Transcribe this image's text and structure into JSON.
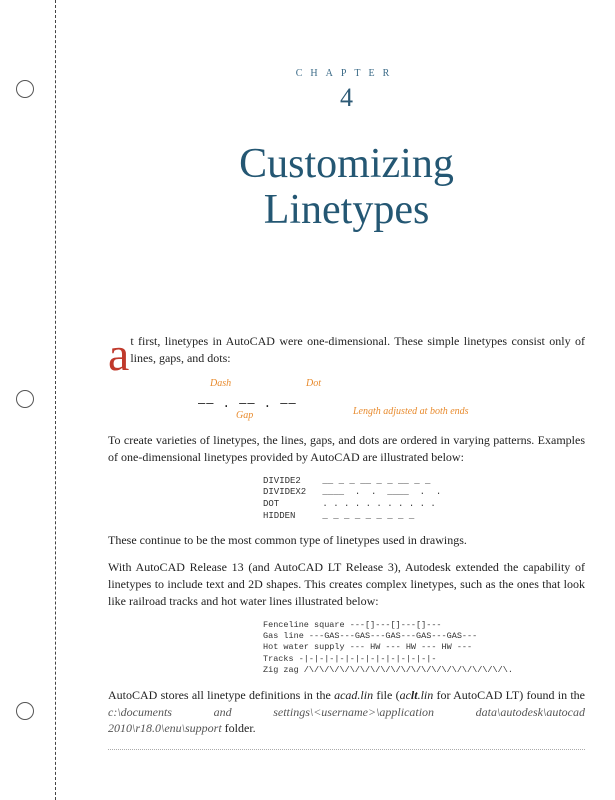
{
  "chapter": {
    "label": "chapter",
    "number": "4",
    "title_line1": "Customizing",
    "title_line2": "Linetypes"
  },
  "dropcap": "a",
  "para1_rest": "t first, linetypes in AutoCAD were one-dimensional. These simple linetypes consist only of lines, gaps, and dots:",
  "diagram1": {
    "dash": "Dash",
    "dot": "Dot",
    "gap": "Gap",
    "length": "Length adjusted at both ends",
    "line": "——  . ——  . ——"
  },
  "para2": "To create varieties of linetypes, the lines, gaps, and dots are ordered in varying patterns. Examples of one-dimensional linetypes provided by AutoCAD are illustrated below:",
  "samples1": "DIVIDE2    __ _ _ __ _ _ __ _ _\nDIVIDEX2   ____  .  .  ____  .  .\nDOT        . . . . . . . . . . .\nHIDDEN     _ _ _ _ _ _ _ _ _",
  "para3": "These continue to be the most common type of linetypes used in drawings.",
  "para4": "With AutoCAD Release 13 (and AutoCAD LT Release 3), Autodesk extended the capability of linetypes to include text and 2D shapes. This creates complex linetypes, such as the ones that look like railroad tracks and hot water lines illustrated below:",
  "samples2": "Fenceline square ---[]---[]---[]---\nGas line ---GAS---GAS---GAS---GAS---GAS---\nHot water supply --- HW --- HW --- HW ---\nTracks -|-|-|-|-|-|-|-|-|-|-|-|-|-\nZig zag /\\/\\/\\/\\/\\/\\/\\/\\/\\/\\/\\/\\/\\/\\/\\/\\/\\/\\/\\/\\.",
  "para5_a": "AutoCAD stores all linetype definitions in the ",
  "para5_file": "acad.lin",
  "para5_b": " file (",
  "para5_ltfile_pre": "ac",
  "para5_ltfile_mid": "lt",
  "para5_ltfile_post": ".lin",
  "para5_c": " for AutoCAD LT) found in the ",
  "para5_path": "c:\\documents and settings\\<username>\\application data\\autodesk\\autocad 2010\\r18.0\\enu\\support",
  "para5_d": "  folder."
}
